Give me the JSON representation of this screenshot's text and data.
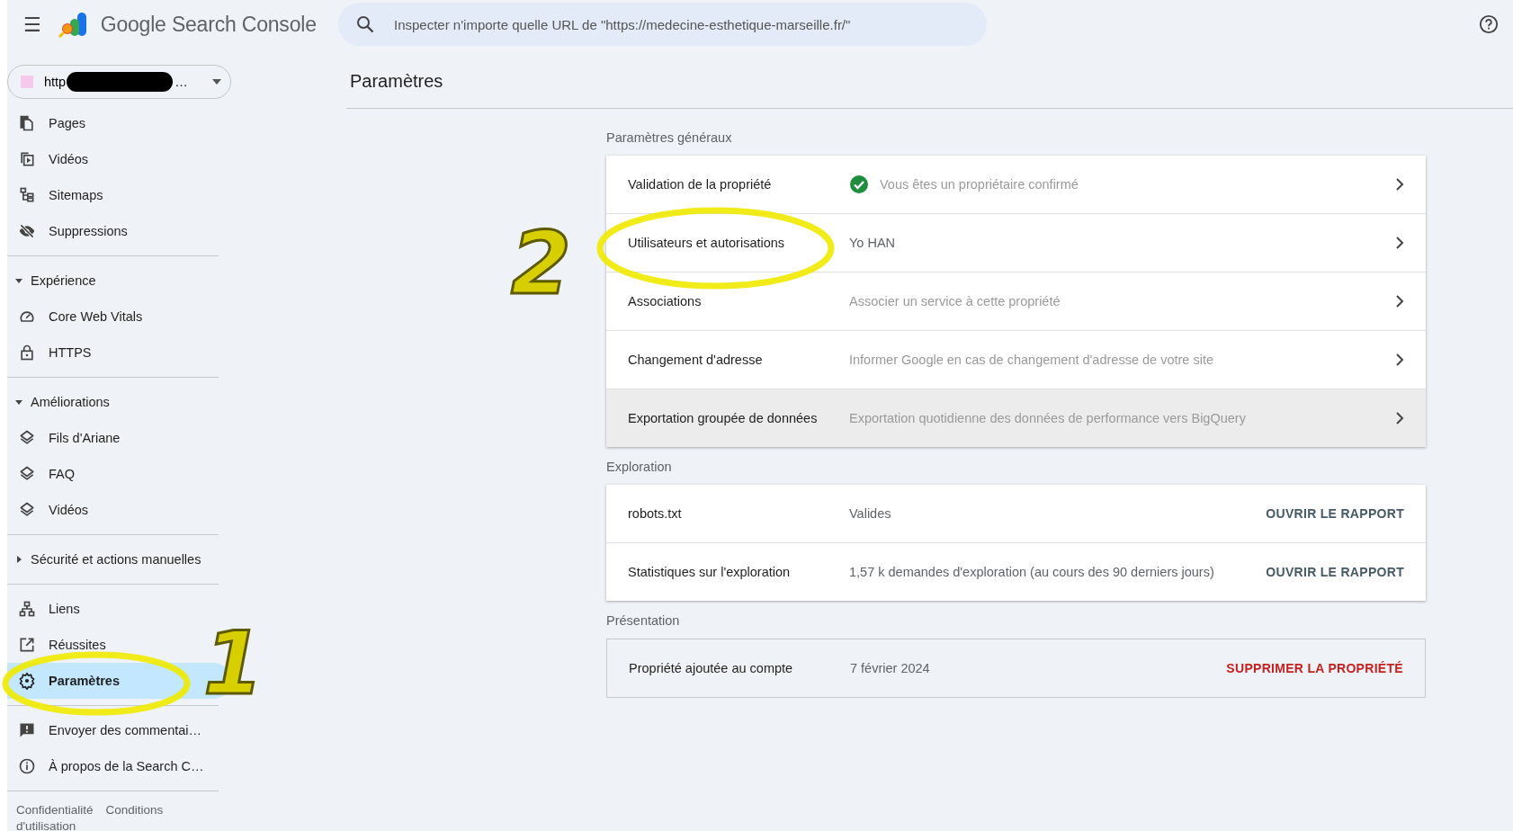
{
  "header": {
    "menu_label": "☰",
    "product": "Google Search Console",
    "search": {
      "placeholder": "Inspecter n'importe quelle URL de \"https://medecine-esthetique-marseille.fr/\""
    }
  },
  "property_selector": {
    "visible_start": "http",
    "visible_end": "…",
    "redacted": true
  },
  "sidebar": {
    "sections": [
      {
        "items": [
          {
            "label": "Pages",
            "selected": false
          },
          {
            "label": "Vidéos",
            "selected": false
          },
          {
            "label": "Sitemaps",
            "selected": false
          },
          {
            "label": "Suppressions",
            "selected": false
          }
        ]
      },
      {
        "heading": "Expérience",
        "expanded": true,
        "items": [
          {
            "label": "Core Web Vitals",
            "selected": false
          },
          {
            "label": "HTTPS",
            "selected": false
          }
        ]
      },
      {
        "heading": "Améliorations",
        "expanded": true,
        "items": [
          {
            "label": "Fils d'Ariane",
            "selected": false
          },
          {
            "label": "FAQ",
            "selected": false
          },
          {
            "label": "Vidéos",
            "selected": false
          }
        ]
      },
      {
        "heading": "Sécurité et actions manuelles",
        "expanded": false
      },
      {
        "items": [
          {
            "label": "Liens",
            "selected": false
          },
          {
            "label": "Réussites",
            "selected": false
          },
          {
            "label": "Paramètres",
            "selected": true
          }
        ]
      },
      {
        "items": [
          {
            "label": "Envoyer des commentai…",
            "selected": false
          },
          {
            "label": "À propos de la Search C…",
            "selected": false
          }
        ]
      }
    ],
    "footer_links": [
      "Confidentialité",
      "Conditions d'utilisation"
    ]
  },
  "main": {
    "title": "Paramètres",
    "sections": [
      {
        "heading": "Paramètres généraux",
        "kind": "list",
        "rows": [
          {
            "kind": "link",
            "label": "Validation de la propriété",
            "value": "Vous êtes un propriétaire confirmé",
            "verified": true,
            "highlighted": false
          },
          {
            "kind": "link",
            "label": "Utilisateurs et autorisations",
            "value": "Yo HAN",
            "value_strong": true,
            "highlighted": false
          },
          {
            "kind": "link",
            "label": "Associations",
            "value": "Associer un service à cette propriété",
            "highlighted": false
          },
          {
            "kind": "link",
            "label": "Changement d'adresse",
            "value": "Informer Google en cas de changement d'adresse de votre site",
            "highlighted": false
          },
          {
            "kind": "link",
            "label": "Exportation groupée de données",
            "value": "Exportation quotidienne des données de performance vers BigQuery",
            "highlighted": true
          }
        ]
      },
      {
        "heading": "Exploration",
        "kind": "list",
        "rows": [
          {
            "kind": "action",
            "label": "robots.txt",
            "value": "Valides",
            "value_strong": true,
            "action": "OUVRIR LE RAPPORT",
            "danger": false
          },
          {
            "kind": "action",
            "label": "Statistiques sur l'exploration",
            "value": "1,57 k demandes d'exploration (au cours des 90 derniers jours)",
            "value_strong": true,
            "action": "OUVRIR LE RAPPORT",
            "danger": false
          }
        ]
      },
      {
        "heading": "Présentation",
        "kind": "summary",
        "rows": [
          {
            "kind": "action",
            "label": "Propriété ajoutée au compte",
            "value": "7 février 2024",
            "value_strong": true,
            "action": "SUPPRIMER LA PROPRIÉTÉ",
            "danger": true
          }
        ]
      }
    ]
  },
  "annotations": [
    {
      "label": "1"
    },
    {
      "label": "2"
    }
  ]
}
